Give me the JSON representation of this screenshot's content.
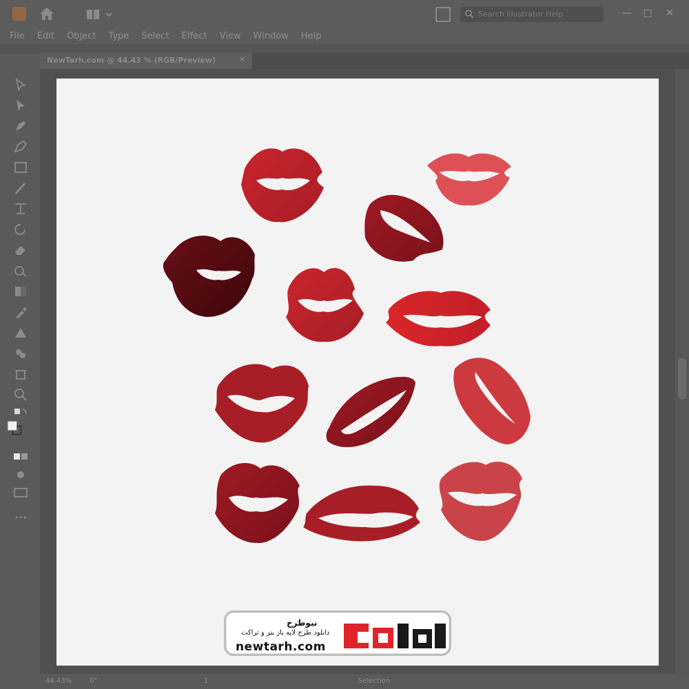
{
  "window": {
    "search_placeholder": "Search Illustrator Help",
    "min_label": "—",
    "max_label": "□",
    "close_label": "✕"
  },
  "menu": [
    "File",
    "Edit",
    "Object",
    "Type",
    "Select",
    "Effect",
    "View",
    "Window",
    "Help"
  ],
  "document_tab": {
    "title": "NewTarh.com @ 44.43 % (RGB/Preview)",
    "close_label": "✕"
  },
  "status": {
    "zoom": "44.43%",
    "rotation": "0°",
    "artboard_nav": "1",
    "tool_name": "Selection"
  },
  "tools": [
    "selection-icon",
    "direct-selection-icon",
    "pen-icon",
    "curvature-icon",
    "rectangle-icon",
    "paintbrush-icon",
    "width-icon",
    "rotate-icon",
    "eraser-icon",
    "shape-builder-icon",
    "gradient-icon",
    "eyedropper-icon",
    "blend-icon",
    "symbol-sprayer-icon",
    "artboard-icon",
    "zoom-icon"
  ],
  "colors": {
    "lips_bright": "#d42a2e",
    "lips_mid": "#b3202a",
    "lips_dark": "#8c1620",
    "lips_darkest": "#4a0a10"
  },
  "watermark": {
    "url": "newtarh.com",
    "brand_fa": "نیوطرح",
    "tagline_fa": "دانلود طرح لایه باز بنر و تراکت",
    "logo_color_red": "#e0232a",
    "logo_color_dark": "#1a1a1a"
  }
}
